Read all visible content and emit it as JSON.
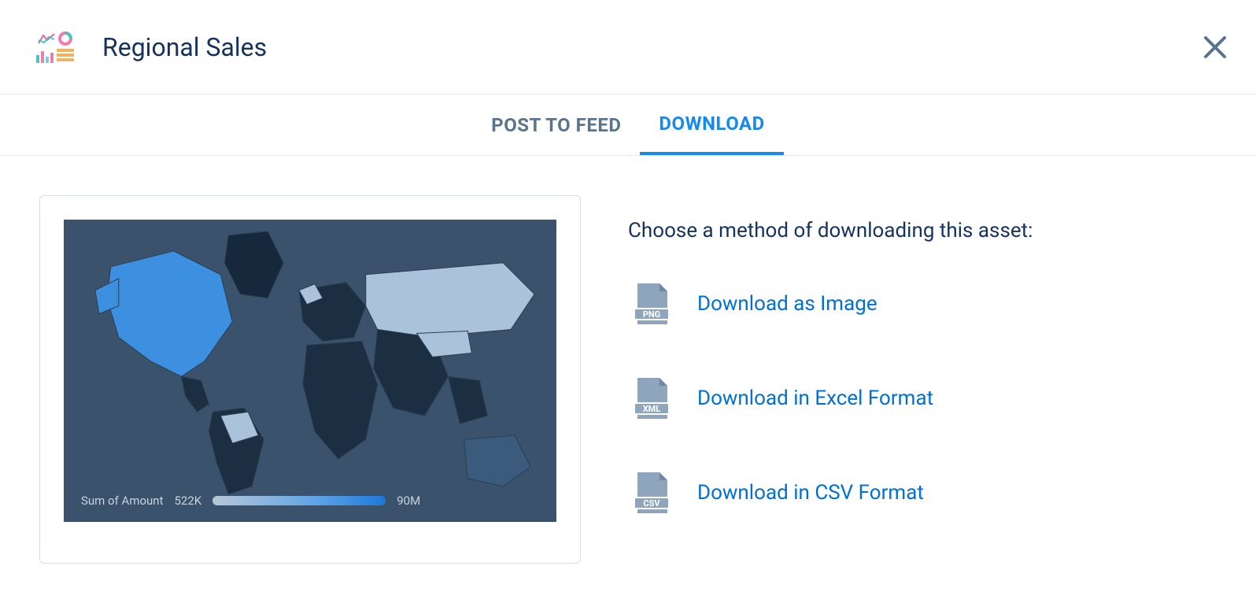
{
  "title": "Regional Sales",
  "tabs": {
    "post": "POST TO FEED",
    "download": "DOWNLOAD"
  },
  "prompt": "Choose a method of downloading this asset:",
  "options": {
    "png": {
      "label": "Download as Image",
      "badge": "PNG"
    },
    "xml": {
      "label": "Download in Excel Format",
      "badge": "XML"
    },
    "csv": {
      "label": "Download in CSV Format",
      "badge": "CSV"
    }
  },
  "legend": {
    "label": "Sum of Amount",
    "min": "522K",
    "max": "90M"
  },
  "chart_data": {
    "type": "heatmap",
    "title": "Regional Sales",
    "metric": "Sum of Amount",
    "scale_min_label": "522K",
    "scale_max_label": "90M",
    "scale_min_value": 522000,
    "scale_max_value": 90000000,
    "note": "Choropleth world map; lighter blue indicates higher values. North America appears highest; Greenland/South America/Africa/parts of Asia appear lowest (dark)."
  }
}
